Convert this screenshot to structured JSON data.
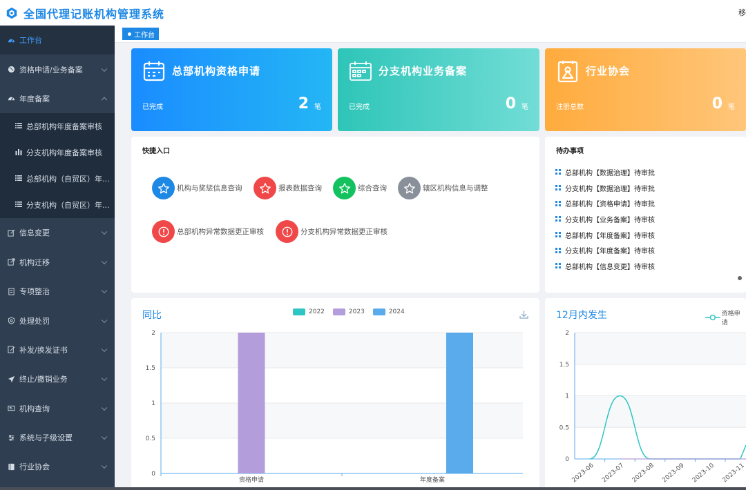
{
  "app": {
    "title": "全国代理记账机构管理系统",
    "user_mark": "移"
  },
  "sidebar": {
    "items": [
      {
        "label": "工作台",
        "icon": "dashboard-icon",
        "active": true
      },
      {
        "label": "资格申请/业务备案",
        "icon": "globe-icon"
      },
      {
        "label": "年度备案",
        "icon": "dashboard-icon",
        "expanded": true
      },
      {
        "label": "信息变更",
        "icon": "edit-icon"
      },
      {
        "label": "机构迁移",
        "icon": "export-icon"
      },
      {
        "label": "专项整治",
        "icon": "document-icon"
      },
      {
        "label": "处理处罚",
        "icon": "shield-icon"
      },
      {
        "label": "补发/换发证书",
        "icon": "document-edit-icon"
      },
      {
        "label": "终止/撤销业务",
        "icon": "send-icon"
      },
      {
        "label": "机构查询",
        "icon": "card-icon"
      },
      {
        "label": "系统与子级设置",
        "icon": "settings-icon"
      },
      {
        "label": "行业协会",
        "icon": "book-icon"
      }
    ],
    "sub_items": [
      {
        "label": "总部机构年度备案审核",
        "icon": "list-icon"
      },
      {
        "label": "分支机构年度备案审核",
        "icon": "bar-chart-icon"
      },
      {
        "label": "总部机构（自贸区）年...",
        "icon": "list-icon"
      },
      {
        "label": "分支机构（自贸区）年...",
        "icon": "list-icon"
      }
    ]
  },
  "tabs": [
    {
      "label": "工作台"
    }
  ],
  "cards": [
    {
      "title": "总部机构资格申请",
      "sub": "已完成",
      "value": "2",
      "unit": "笔",
      "icon": "calendar-icon"
    },
    {
      "title": "分支机构业务备案",
      "sub": "已完成",
      "value": "0",
      "unit": "笔",
      "icon": "calendar-grid-icon"
    },
    {
      "title": "行业协会",
      "sub": "注册总数",
      "value": "0",
      "unit": "笔",
      "icon": "badge-icon"
    }
  ],
  "quick": {
    "title": "快捷入口",
    "items": [
      {
        "label": "机构与奖惩信息查询",
        "color": "#1e88e5",
        "icon": "star-icon"
      },
      {
        "label": "报表数据查询",
        "color": "#f04848",
        "icon": "star-icon"
      },
      {
        "label": "综合查询",
        "color": "#13c25f",
        "icon": "star-icon"
      },
      {
        "label": "辖区机构信息与调整",
        "color": "#8a9099",
        "icon": "star-icon"
      },
      {
        "label": "总部机构异常数据更正审核",
        "color": "#f04848",
        "icon": "alert-icon"
      },
      {
        "label": "分支机构异常数据更正审核",
        "color": "#f04848",
        "icon": "alert-icon"
      }
    ]
  },
  "todo": {
    "title": "待办事项",
    "items": [
      "总部机构【数据治理】待审批",
      "分支机构【数据治理】待审批",
      "总部机构【资格申请】待审批",
      "分支机构【业务备案】待审核",
      "总部机构【年度备案】待审核",
      "分支机构【年度备案】待审核",
      "总部机构【信息变更】待审核"
    ]
  },
  "colors": {
    "accent": "#1e88e5",
    "sidebar_bg": "#2f3e50",
    "series_2022": "#2ec5c5",
    "series_2023": "#b39ddb",
    "series_2024": "#5aabeb"
  },
  "chart_data": [
    {
      "type": "bar",
      "title": "同比",
      "categories": [
        "资格申请",
        "年度备案"
      ],
      "series": [
        {
          "name": "2022",
          "values": [
            0,
            0
          ],
          "color": "#2ec5c5"
        },
        {
          "name": "2023",
          "values": [
            2,
            0
          ],
          "color": "#b39ddb"
        },
        {
          "name": "2024",
          "values": [
            0,
            2
          ],
          "color": "#5aabeb"
        }
      ],
      "ylim": [
        0,
        2
      ],
      "yticks": [
        "0",
        "0.5",
        "1",
        "1.5",
        "2"
      ],
      "legend": "top-center",
      "grid": true
    },
    {
      "type": "line",
      "title": "12月内发生",
      "categories": [
        "2023-06",
        "2023-07",
        "2023-08",
        "2023-09",
        "2023-10",
        "2023-11"
      ],
      "series": [
        {
          "name": "资格申请",
          "values": [
            0,
            1,
            0,
            0,
            0,
            0
          ],
          "color": "#2ec5c5"
        }
      ],
      "ylim": [
        0,
        2
      ],
      "yticks": [
        "0",
        "0.5",
        "1",
        "1.5",
        "2"
      ],
      "legend": "top-right",
      "grid": true
    }
  ]
}
